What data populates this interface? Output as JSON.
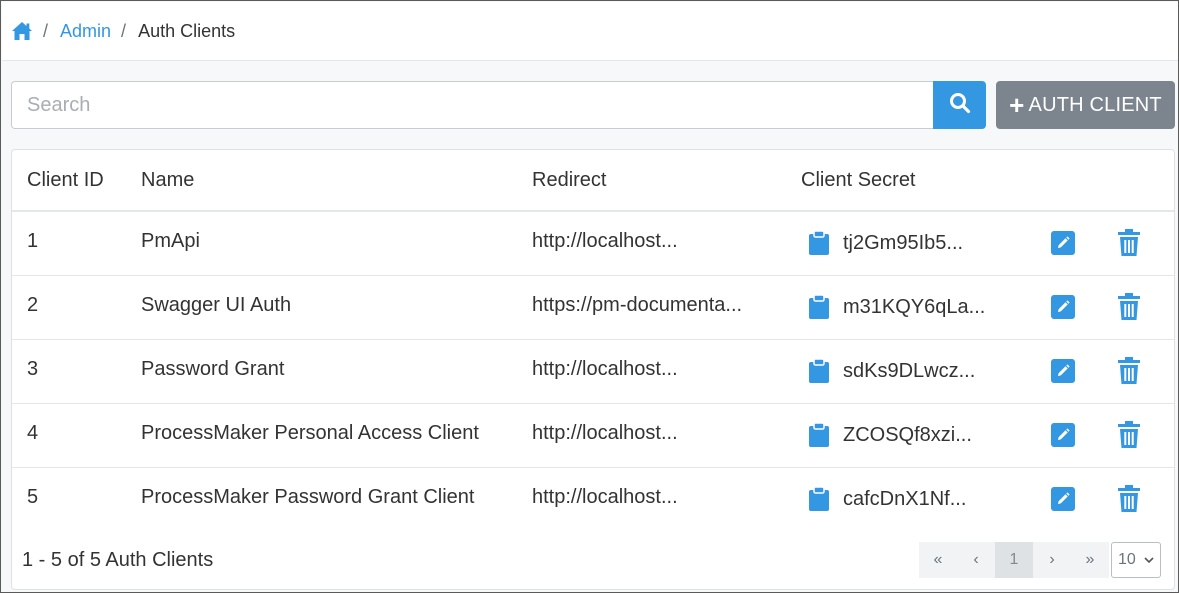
{
  "breadcrumb": {
    "home_icon": "home-icon",
    "items": [
      "Admin",
      "Auth Clients"
    ]
  },
  "search": {
    "placeholder": "Search",
    "value": ""
  },
  "toolbar": {
    "add_label": "AUTH CLIENT"
  },
  "table": {
    "columns": [
      "Client ID",
      "Name",
      "Redirect",
      "Client Secret"
    ],
    "rows": [
      {
        "id": "1",
        "name": "PmApi",
        "redirect": "http://localhost...",
        "secret": "tj2Gm95Ib5..."
      },
      {
        "id": "2",
        "name": "Swagger UI Auth",
        "redirect": "https://pm-documenta...",
        "secret": "m31KQY6qLa..."
      },
      {
        "id": "3",
        "name": "Password Grant",
        "redirect": "http://localhost...",
        "secret": "sdKs9DLwcz..."
      },
      {
        "id": "4",
        "name": "ProcessMaker Personal Access Client",
        "redirect": "http://localhost...",
        "secret": "ZCOSQf8xzi..."
      },
      {
        "id": "5",
        "name": "ProcessMaker Password Grant Client",
        "redirect": "http://localhost...",
        "secret": "cafcDnX1Nf..."
      }
    ]
  },
  "footer": {
    "summary": "1 - 5 of 5 Auth Clients",
    "pager": {
      "first": "«",
      "prev": "‹",
      "current": "1",
      "next": "›",
      "last": "»"
    },
    "per_page": "10"
  },
  "colors": {
    "accent": "#3397e1",
    "secondary_button": "#7c858e"
  }
}
